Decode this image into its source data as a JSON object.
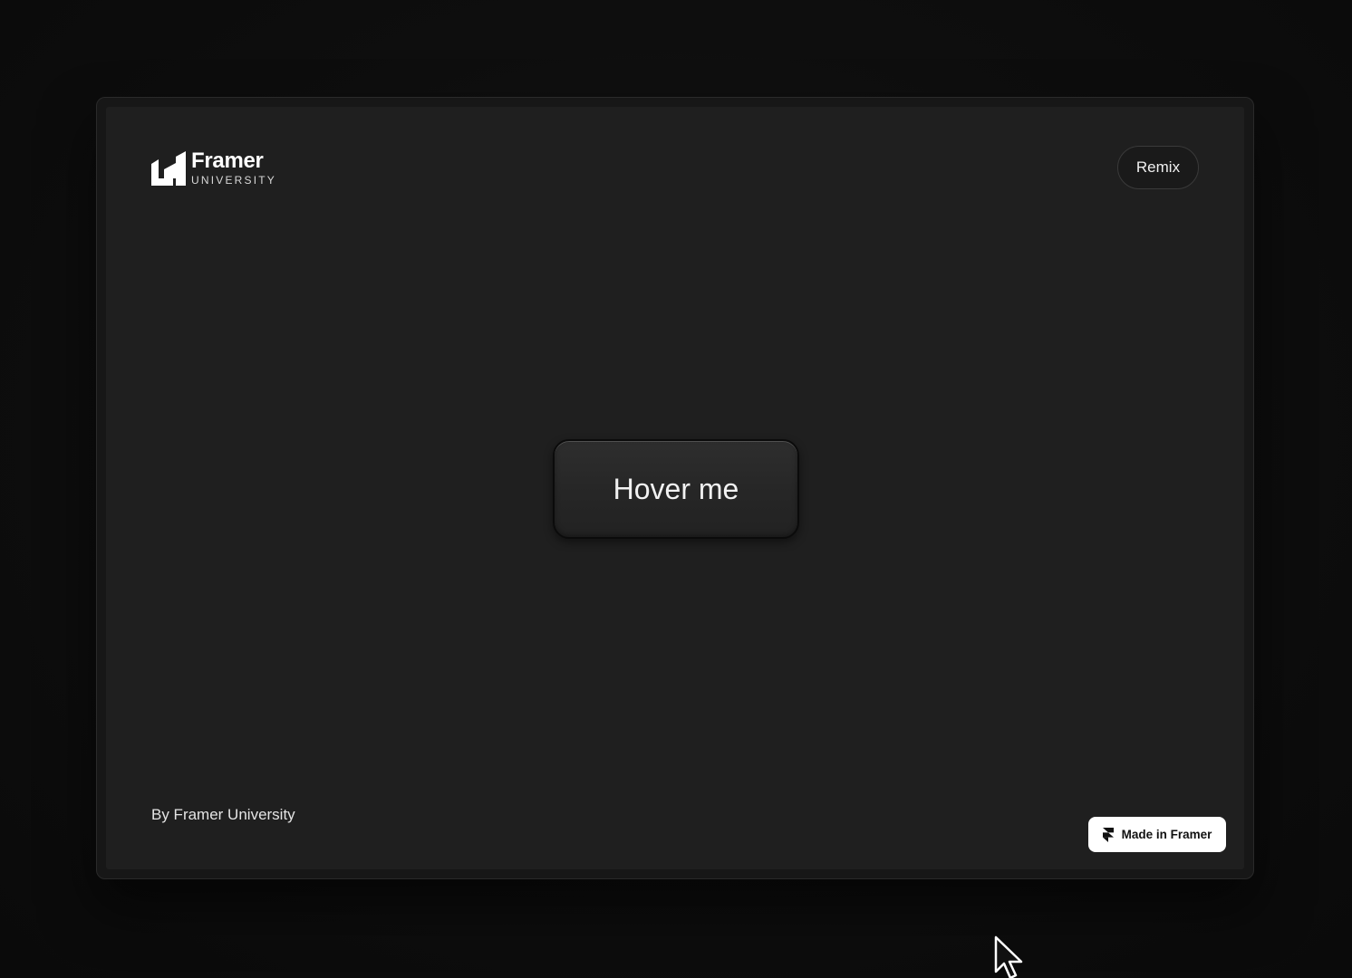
{
  "brand": {
    "title": "Framer",
    "subtitle": "UNIVERSITY",
    "logo_icon": "framer-university-logo-icon"
  },
  "header": {
    "remix_label": "Remix"
  },
  "main": {
    "button_label": "Hover me"
  },
  "footer": {
    "credit": "By Framer University",
    "badge_label": "Made in Framer",
    "badge_icon": "framer-icon"
  },
  "colors": {
    "page_background": "#0d0d0d",
    "canvas_background": "#1f1f1f",
    "badge_background": "#ffffff",
    "text": "#f2f2f2"
  }
}
